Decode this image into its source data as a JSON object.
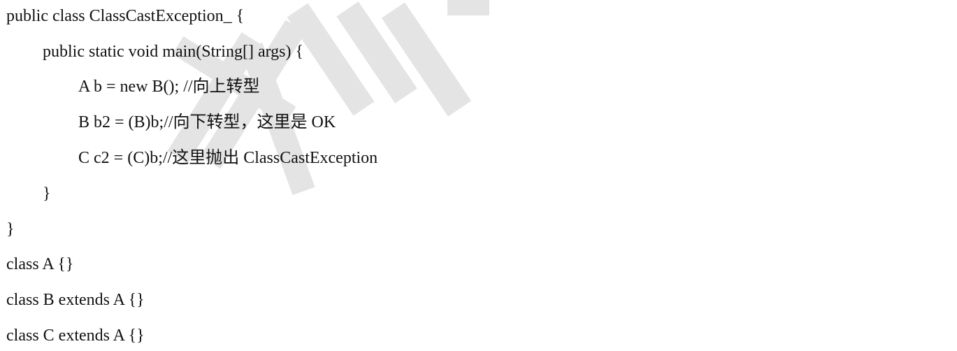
{
  "code": {
    "lines": [
      "public class ClassCastException_ {",
      "public static void main(String[] args) {",
      "A b = new B(); //向上转型",
      "B b2 = (B)b;//向下转型，这里是 OK",
      "C c2 = (C)b;//这里抛出 ClassCastException",
      "}",
      "}",
      "class A {}",
      "class B extends A {}",
      "class C extends A {}"
    ]
  },
  "watermark": {
    "color": "#e6e6e6"
  }
}
